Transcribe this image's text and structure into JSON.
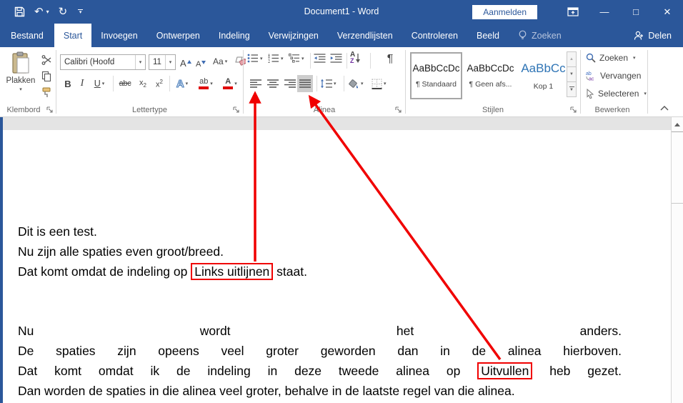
{
  "titlebar": {
    "title": "Document1 - Word",
    "signin": "Aanmelden"
  },
  "tabs": {
    "items": [
      {
        "label": "Bestand"
      },
      {
        "label": "Start"
      },
      {
        "label": "Invoegen"
      },
      {
        "label": "Ontwerpen"
      },
      {
        "label": "Indeling"
      },
      {
        "label": "Verwijzingen"
      },
      {
        "label": "Verzendlijsten"
      },
      {
        "label": "Controleren"
      },
      {
        "label": "Beeld"
      }
    ],
    "search": "Zoeken",
    "share": "Delen"
  },
  "ribbon": {
    "clipboard": {
      "group": "Klembord",
      "paste": "Plakken"
    },
    "font": {
      "group": "Lettertype",
      "name": "Calibri (Hoofd",
      "size": "11",
      "grow": "A",
      "shrink": "A",
      "case": "Aa",
      "bold": "B",
      "italic": "I",
      "underline": "U",
      "strike": "abc",
      "sub_base": "x",
      "sub_digit": "2",
      "sup_base": "x",
      "sup_digit": "2",
      "effects": "A",
      "highlight": "ab",
      "color": "A"
    },
    "paragraph": {
      "group": "Alinea",
      "pilcrow": "¶",
      "sort_a": "A",
      "sort_z": "Z"
    },
    "styles": {
      "group": "Stijlen",
      "items": [
        {
          "preview": "AaBbCcDc",
          "label": "¶ Standaard"
        },
        {
          "preview": "AaBbCcDc",
          "label": "¶ Geen afs..."
        },
        {
          "preview": "AaBbCc",
          "label": "Kop 1"
        }
      ]
    },
    "editing": {
      "group": "Bewerken",
      "find": "Zoeken",
      "replace": "Vervangen",
      "select": "Selecteren"
    }
  },
  "document": {
    "para1": {
      "line1": "Dit is een test.",
      "line2": "Nu zijn alle spaties even groot/breed.",
      "line3_before": "Dat komt omdat de indeling op ",
      "line3_boxed": "Links uitlijnen",
      "line3_after": " staat."
    },
    "para2": {
      "line1": "Nu wordt het anders.",
      "line2": "De spaties zijn opeens veel groter geworden dan in de alinea hierboven.",
      "line3_before": "Dat komt omdat ik de indeling in deze tweede alinea op ",
      "line3_boxed": "Uitvullen",
      "line3_after": " heb gezet.",
      "line4": "Dan worden de spaties in die alinea veel groter, behalve in de laatste regel van die alinea."
    }
  },
  "colors": {
    "titlebar_blue": "#2b579a",
    "annotation_red": "#ff0000",
    "heading_blue": "#2e74b5",
    "selected_gray": "#cdcdcd"
  }
}
